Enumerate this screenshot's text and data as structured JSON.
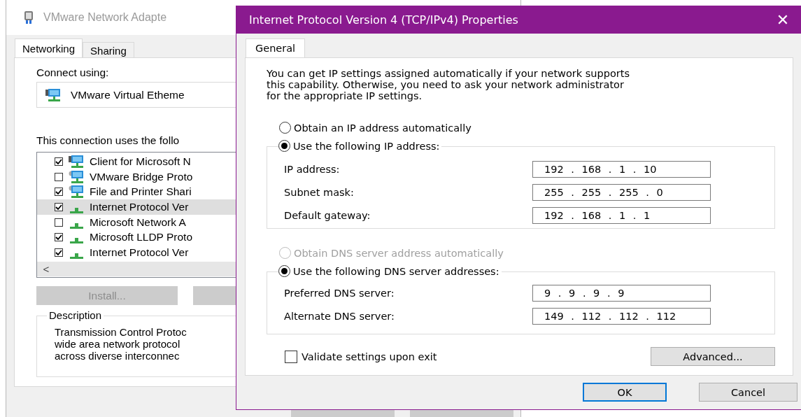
{
  "back_window": {
    "title": "VMware Network Adapte",
    "tabs": [
      {
        "label": "Networking",
        "selected": true
      },
      {
        "label": "Sharing",
        "selected": false
      }
    ],
    "connect_using_label": "Connect using:",
    "adapter": "VMware Virtual Etheme",
    "items_label": "This connection uses the follo",
    "items": [
      {
        "label": "Client for Microsoft N",
        "checked": true,
        "kind": "monitor",
        "selected": false
      },
      {
        "label": "VMware Bridge Proto",
        "checked": false,
        "kind": "gear-monitor",
        "selected": false
      },
      {
        "label": "File and Printer Shari",
        "checked": true,
        "kind": "gear-monitor",
        "selected": false
      },
      {
        "label": "Internet Protocol Ver",
        "checked": true,
        "kind": "protocol",
        "selected": true
      },
      {
        "label": "Microsoft Network A",
        "checked": false,
        "kind": "protocol",
        "selected": false
      },
      {
        "label": "Microsoft LLDP Proto",
        "checked": true,
        "kind": "protocol",
        "selected": false
      },
      {
        "label": "Internet Protocol Ver",
        "checked": true,
        "kind": "protocol",
        "selected": false
      }
    ],
    "scroll_left": "<",
    "buttons": [
      {
        "label": "Install...",
        "disabled": true
      },
      {
        "disabled": true
      }
    ],
    "description": {
      "legend": "Description",
      "lines": [
        "Transmission Control Protoc",
        "wide area network protocol",
        "across diverse interconnec"
      ]
    }
  },
  "dialog": {
    "title": "Internet Protocol Version 4 (TCP/IPv4) Properties",
    "close": "✕",
    "tabs": [
      {
        "label": "General",
        "selected": true
      }
    ],
    "intro_lines": [
      "You can get IP settings assigned automatically if your network supports",
      "this capability. Otherwise, you need to ask your network administrator",
      "for the appropriate IP settings."
    ],
    "ip_radios": [
      {
        "label": "Obtain an IP address automatically",
        "selected": false,
        "disabled": false
      },
      {
        "label": "Use the following IP address:",
        "selected": true,
        "disabled": false
      }
    ],
    "ip_fields": [
      {
        "label": "IP address:",
        "value": "192 . 168 . 1 . 10"
      },
      {
        "label": "Subnet mask:",
        "value": "255 . 255 . 255 . 0"
      },
      {
        "label": "Default gateway:",
        "value": "192 . 168 . 1 . 1"
      }
    ],
    "dns_radios": [
      {
        "label": "Obtain DNS server address automatically",
        "selected": false,
        "disabled": true
      },
      {
        "label": "Use the following DNS server addresses:",
        "selected": true,
        "disabled": false
      }
    ],
    "dns_fields": [
      {
        "label": "Preferred DNS server:",
        "value": "9 . 9 . 9 . 9"
      },
      {
        "label": "Alternate DNS server:",
        "value": "149 . 112 . 112 . 112"
      }
    ],
    "validate": {
      "label": "Validate settings upon exit",
      "checked": false
    },
    "advanced": "Advanced...",
    "buttons": [
      {
        "label": "OK",
        "default": true
      },
      {
        "label": "Cancel",
        "default": false
      }
    ]
  }
}
